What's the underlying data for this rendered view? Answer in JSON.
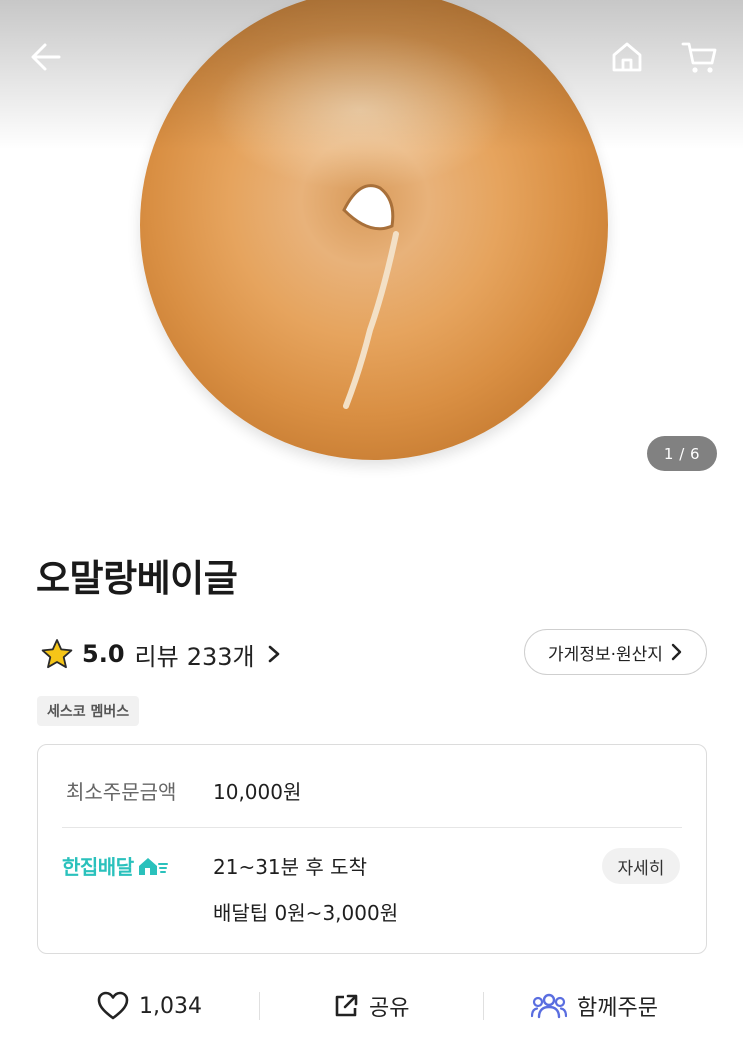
{
  "pager": {
    "current": "1",
    "total": "6",
    "label": "1 / 6"
  },
  "store": {
    "name": "오말랑베이글",
    "rating": "5.0",
    "review_label": "리뷰",
    "review_count": "233개",
    "info_button_label": "가게정보·원산지",
    "member_badge": "세스코 멤버스"
  },
  "delivery": {
    "min_order_label": "최소주문금액",
    "min_order_value": "10,000원",
    "brand": "한집배달",
    "time": "21~31분 후 도착",
    "tip": "배달팁 0원~3,000원",
    "detail_label": "자세히"
  },
  "actions": {
    "like_count": "1,034",
    "share_label": "공유",
    "group_order_label": "함께주문"
  },
  "colors": {
    "accent": "#2ac1bc",
    "star": "#f5c518",
    "group_icon": "#5a6ee0"
  },
  "icons": [
    "back-arrow-icon",
    "home-icon",
    "cart-icon",
    "star-icon",
    "chevron-right-icon",
    "heart-icon",
    "share-icon",
    "people-icon"
  ]
}
